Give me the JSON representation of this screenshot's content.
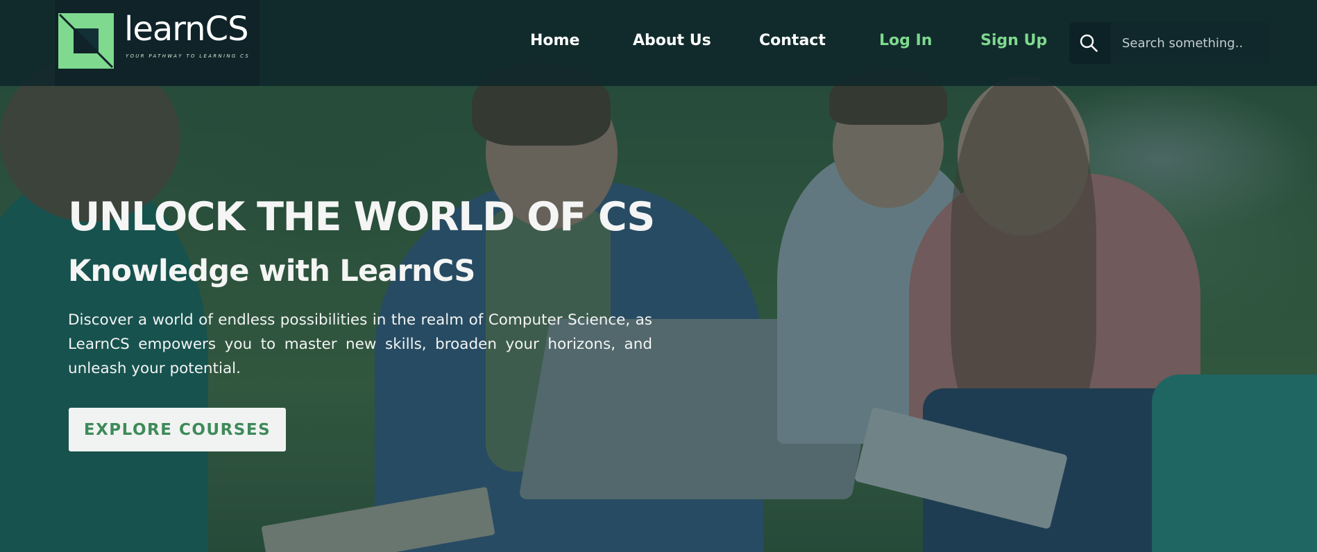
{
  "brand": {
    "name": "learnCS",
    "tagline": "YOUR PATHWAY TO LEARNING CS",
    "primary_color": "#7fd98f",
    "dark_color": "#0f2328"
  },
  "nav": {
    "home": "Home",
    "about": "About Us",
    "contact": "Contact",
    "login": "Log In",
    "signup": "Sign Up"
  },
  "search": {
    "icon": "search-icon",
    "placeholder": "Search something.."
  },
  "hero": {
    "title": "UNLOCK THE WORLD OF CS",
    "subtitle": "Knowledge with LearnCS",
    "description": "Discover a world of endless possibilities in the realm of Computer Science, as LearnCS empowers you to master new skills, broaden your horizons, and unleash your potential.",
    "cta_label": "EXPLORE COURSES"
  }
}
